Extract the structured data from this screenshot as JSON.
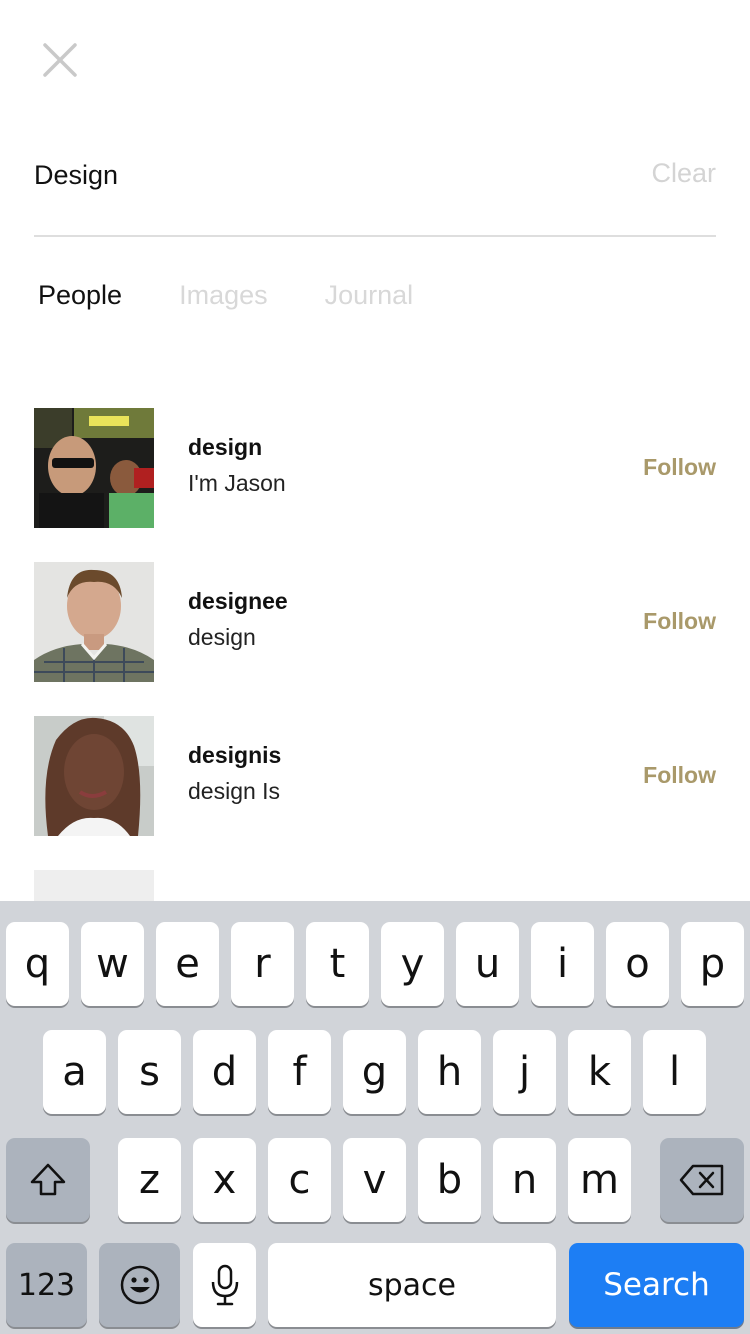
{
  "header": {
    "close_icon": "close-icon"
  },
  "search": {
    "value": "Design",
    "clear_label": "Clear"
  },
  "tabs": [
    {
      "label": "People",
      "active": true
    },
    {
      "label": "Images",
      "active": false
    },
    {
      "label": "Journal",
      "active": false
    }
  ],
  "results": [
    {
      "username": "design",
      "bio": "I'm Jason",
      "follow_label": "Follow"
    },
    {
      "username": "designee",
      "bio": "design",
      "follow_label": "Follow"
    },
    {
      "username": "designis",
      "bio": "design Is",
      "follow_label": "Follow"
    },
    {
      "username": "",
      "bio": "",
      "follow_label": ""
    }
  ],
  "colors": {
    "accent": "#a9996a",
    "search_key": "#1d7ef4",
    "keyboard_bg": "#d1d4d9"
  },
  "keyboard": {
    "row1": [
      "q",
      "w",
      "e",
      "r",
      "t",
      "y",
      "u",
      "i",
      "o",
      "p"
    ],
    "row2": [
      "a",
      "s",
      "d",
      "f",
      "g",
      "h",
      "j",
      "k",
      "l"
    ],
    "row3": [
      "z",
      "x",
      "c",
      "v",
      "b",
      "n",
      "m"
    ],
    "numbers_label": "123",
    "space_label": "space",
    "search_label": "Search",
    "icons": {
      "shift": "shift-icon",
      "delete": "backspace-icon",
      "emoji": "emoji-icon",
      "mic": "microphone-icon"
    }
  }
}
